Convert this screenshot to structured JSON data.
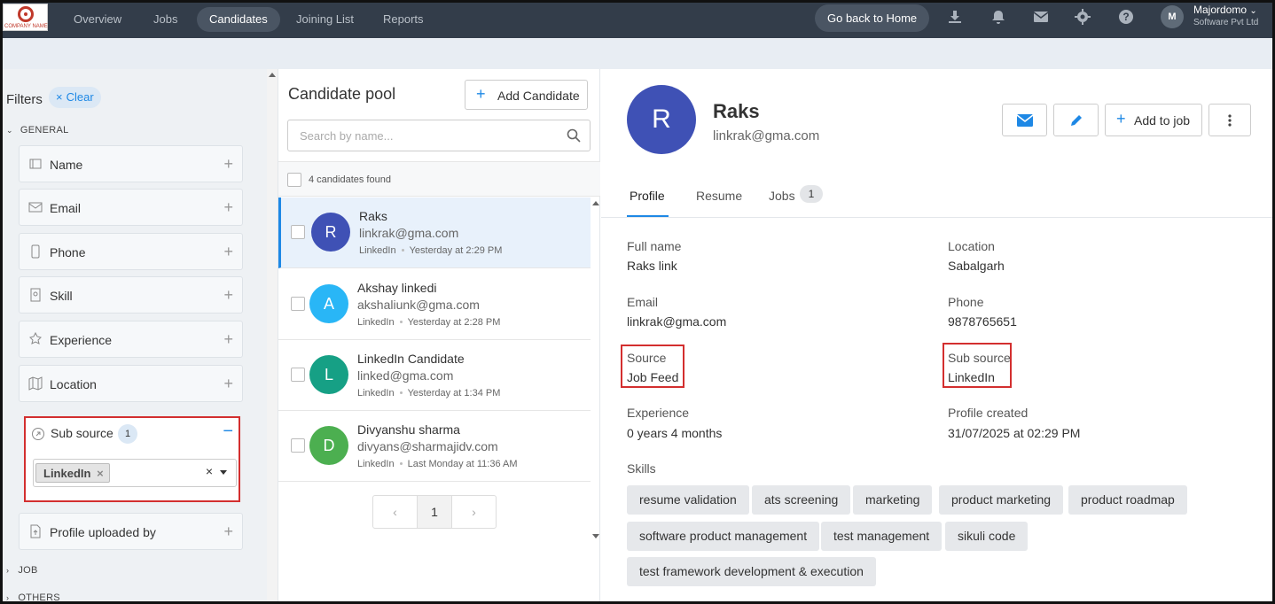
{
  "logo": {
    "text": "COMPANY NAME"
  },
  "nav": {
    "items": [
      {
        "label": "Overview"
      },
      {
        "label": "Jobs"
      },
      {
        "label": "Candidates"
      },
      {
        "label": "Joining List"
      },
      {
        "label": "Reports"
      }
    ],
    "active": "Candidates",
    "home_button": "Go back to Home",
    "icons": [
      "download-icon",
      "bell-icon",
      "mail-icon",
      "gear-icon",
      "help-icon"
    ],
    "user_initial": "M",
    "company_name": "Majordomo",
    "company_sub": "Software Pvt Ltd"
  },
  "filters": {
    "title": "Filters",
    "clear_label": "Clear",
    "sections": {
      "general": "GENERAL",
      "job": "JOB",
      "others": "OTHERS"
    },
    "items": [
      {
        "label": "Name",
        "icon": "name-icon"
      },
      {
        "label": "Email",
        "icon": "email-icon"
      },
      {
        "label": "Phone",
        "icon": "phone-icon"
      },
      {
        "label": "Skill",
        "icon": "skill-icon"
      },
      {
        "label": "Experience",
        "icon": "experience-icon"
      },
      {
        "label": "Location",
        "icon": "location-icon"
      }
    ],
    "sub_source": {
      "label": "Sub source",
      "count": "1",
      "selected": "LinkedIn"
    },
    "profile_uploaded_by": "Profile uploaded by"
  },
  "pool": {
    "title": "Candidate pool",
    "add_button": "Add Candidate",
    "search_placeholder": "Search by name...",
    "found_text": "4 candidates found",
    "candidates": [
      {
        "initial": "R",
        "name": "Raks",
        "email": "linkrak@gma.com",
        "source": "LinkedIn",
        "time": "Yesterday at 2:29 PM",
        "color": "#3f51b5"
      },
      {
        "initial": "A",
        "name": "Akshay linkedi",
        "email": "akshaliunk@gma.com",
        "source": "LinkedIn",
        "time": "Yesterday at 2:28 PM",
        "color": "#29b6f6"
      },
      {
        "initial": "L",
        "name": "LinkedIn Candidate",
        "email": "linked@gma.com",
        "source": "LinkedIn",
        "time": "Yesterday at 1:34 PM",
        "color": "#16a085"
      },
      {
        "initial": "D",
        "name": "Divyanshu sharma",
        "email": "divyans@sharmajidv.com",
        "source": "LinkedIn",
        "time": "Last Monday at 11:36 AM",
        "color": "#4caf50"
      }
    ],
    "page": "1",
    "prev": "‹",
    "next": "›"
  },
  "detail": {
    "initial": "R",
    "name": "Raks",
    "email": "linkrak@gma.com",
    "add_to_job": "Add to job",
    "tabs": [
      {
        "label": "Profile"
      },
      {
        "label": "Resume"
      },
      {
        "label": "Jobs"
      }
    ],
    "jobs_count": "1",
    "fields": {
      "full_name": {
        "label": "Full name",
        "value": "Raks link"
      },
      "location": {
        "label": "Location",
        "value": "Sabalgarh"
      },
      "email": {
        "label": "Email",
        "value": "linkrak@gma.com"
      },
      "phone": {
        "label": "Phone",
        "value": "9878765651"
      },
      "source": {
        "label": "Source",
        "value": "Job Feed"
      },
      "sub_source": {
        "label": "Sub source",
        "value": "LinkedIn"
      },
      "experience": {
        "label": "Experience",
        "value": "0 years 4 months"
      },
      "profile_created": {
        "label": "Profile created",
        "value": "31/07/2025 at 02:29 PM"
      }
    },
    "skills_label": "Skills",
    "skills": [
      "resume validation",
      "ats screening",
      "marketing",
      "product marketing",
      "product roadmap",
      "software product management",
      "test management",
      "sikuli code",
      "test framework development & execution"
    ]
  },
  "colors": {
    "accent": "#1e88e5",
    "highlight": "#d32f2f",
    "topbar": "#333d4a"
  }
}
